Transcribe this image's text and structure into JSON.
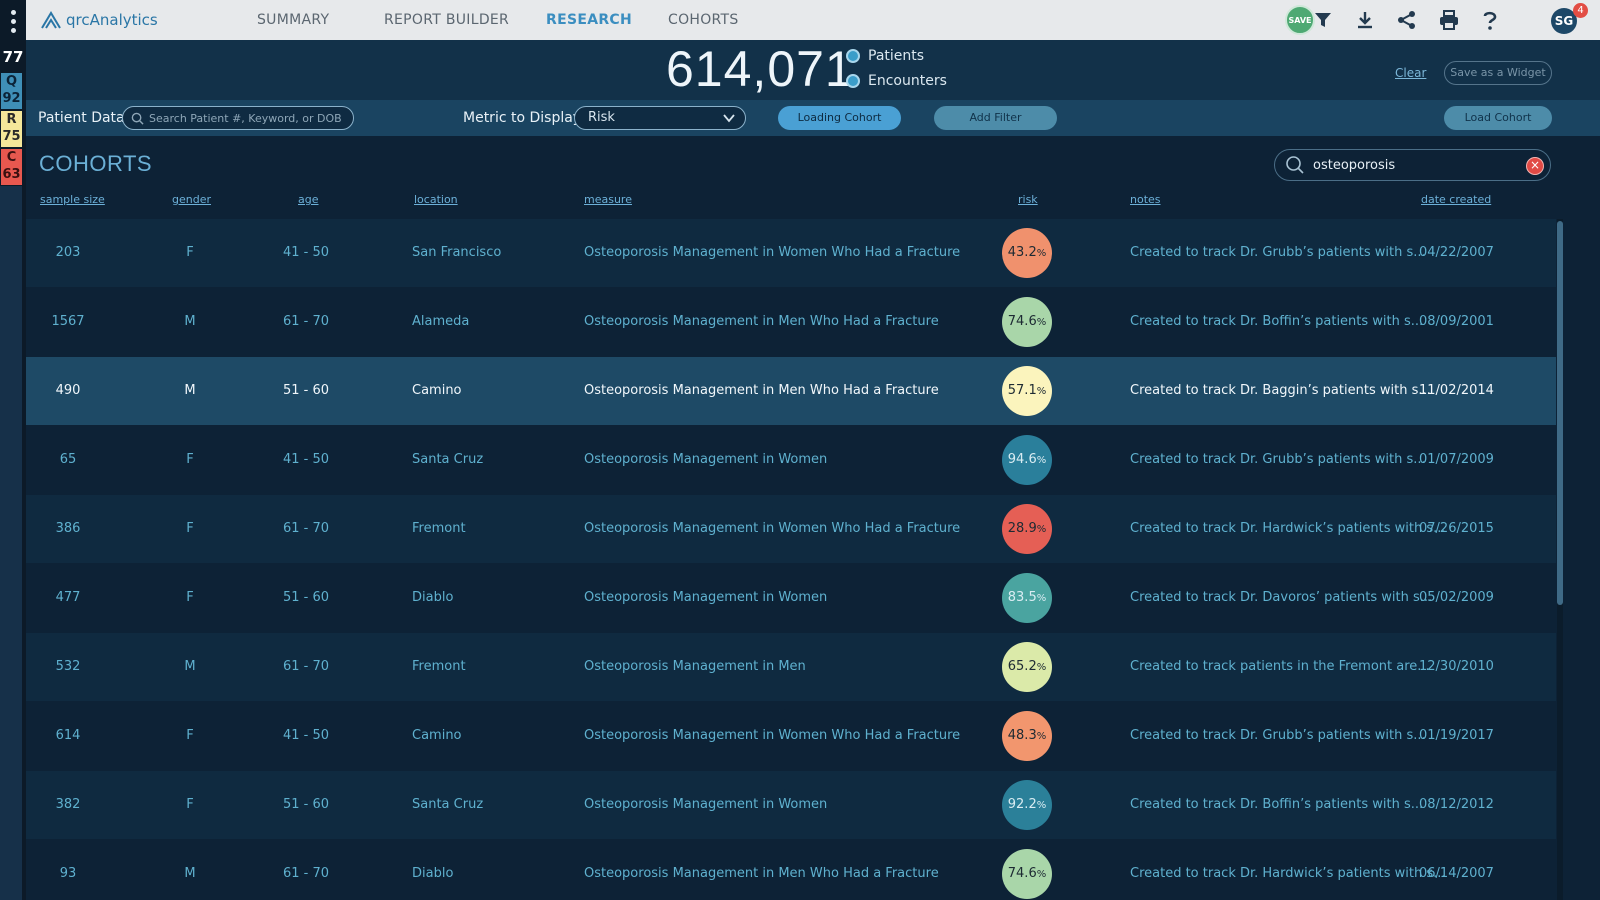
{
  "rail": {
    "total_score": "77",
    "metrics": [
      {
        "letter": "Q",
        "value": "92"
      },
      {
        "letter": "R",
        "value": "75"
      },
      {
        "letter": "C",
        "value": "63"
      }
    ]
  },
  "app": {
    "name": "qrcAnalytics"
  },
  "nav": {
    "tabs": [
      {
        "label": "SUMMARY"
      },
      {
        "label": "REPORT BUILDER"
      },
      {
        "label": "RESEARCH"
      },
      {
        "label": "COHORTS"
      }
    ],
    "active_tab": "RESEARCH",
    "save_label": "SAVE",
    "user_initials": "SG",
    "notification_count": "4",
    "icons": [
      "save-icon",
      "filter-icon",
      "download-icon",
      "share-icon",
      "print-icon",
      "help-icon"
    ]
  },
  "summary": {
    "count": "614,071",
    "radio_patients": "Patients",
    "radio_encounters": "Encounters",
    "clear_label": "Clear",
    "save_widget_label": "Save  as a Widget"
  },
  "filters": {
    "patient_data_label": "Patient Data",
    "search_placeholder": "Search Patient #, Keyword, or DOB",
    "metric_label": "Metric to Display",
    "metric_value": "Risk",
    "loading_cohort_label": "Loading Cohort",
    "add_filter_label": "Add Filter",
    "load_cohort_label": "Load Cohort"
  },
  "cohorts": {
    "title": "COHORTS",
    "search_value": "osteoporosis",
    "columns": [
      "sample size",
      "gender",
      "age",
      "location",
      "measure",
      "risk",
      "notes",
      "date created"
    ],
    "rows": [
      {
        "size": "203",
        "gender": "F",
        "age": "41 - 50",
        "location": "San Francisco",
        "measure": "Osteoporosis Management in Women Who Had a Fracture",
        "risk": "43.2",
        "risk_color": "#f0916d",
        "notes": "Created to track Dr. Grubb’s patients with s...",
        "date": "04/22/2007"
      },
      {
        "size": "1567",
        "gender": "M",
        "age": "61 - 70",
        "location": "Alameda",
        "measure": "Osteoporosis Management in Men Who Had a Fracture",
        "risk": "74.6",
        "risk_color": "#a9d6a9",
        "notes": "Created to track Dr. Boffin’s patients with s...",
        "date": "08/09/2001"
      },
      {
        "size": "490",
        "gender": "M",
        "age": "51 - 60",
        "location": "Camino",
        "measure": "Osteoporosis Management in Men Who Had a Fracture",
        "risk": "57.1",
        "risk_color": "#fbf4bd",
        "notes": "Created to track Dr. Baggin’s patients with s...",
        "date": "11/02/2014"
      },
      {
        "size": "65",
        "gender": "F",
        "age": "41 - 50",
        "location": "Santa Cruz",
        "measure": "Osteoporosis Management in Women",
        "risk": "94.6",
        "risk_color": "#2a7f9b",
        "notes": "Created to track Dr. Grubb’s patients with s...",
        "date": "01/07/2009"
      },
      {
        "size": "386",
        "gender": "F",
        "age": "61 - 70",
        "location": "Fremont",
        "measure": "Osteoporosis Management in Women Who Had a Fracture",
        "risk": "28.9",
        "risk_color": "#e55f55",
        "notes": "Created to track Dr. Hardwick’s patients with s...",
        "date": "07/26/2015"
      },
      {
        "size": "477",
        "gender": "F",
        "age": "51 - 60",
        "location": "Diablo",
        "measure": "Osteoporosis Management in Women",
        "risk": "83.5",
        "risk_color": "#4aa4a0",
        "notes": "Created to track Dr. Davoros’ patients with s...",
        "date": "05/02/2009"
      },
      {
        "size": "532",
        "gender": "M",
        "age": "61 - 70",
        "location": "Fremont",
        "measure": "Osteoporosis Management in Men",
        "risk": "65.2",
        "risk_color": "#dbeaa9",
        "notes": "Created to track patients in the Fremont are...",
        "date": "12/30/2010"
      },
      {
        "size": "614",
        "gender": "F",
        "age": "41 - 50",
        "location": "Camino",
        "measure": "Osteoporosis Management in Women Who Had a Fracture",
        "risk": "48.3",
        "risk_color": "#f2966e",
        "notes": "Created to track Dr. Grubb’s patients with s...",
        "date": "01/19/2017"
      },
      {
        "size": "382",
        "gender": "F",
        "age": "51 - 60",
        "location": "Santa Cruz",
        "measure": "Osteoporosis Management in Women",
        "risk": "92.2",
        "risk_color": "#2b8099",
        "notes": "Created to track Dr. Boffin’s patients with s...",
        "date": "08/12/2012"
      },
      {
        "size": "93",
        "gender": "M",
        "age": "61 - 70",
        "location": "Diablo",
        "measure": "Osteoporosis Management in Men Who Had a Fracture",
        "risk": "74.6",
        "risk_color": "#a9d6a9",
        "notes": "Created to track Dr. Hardwick’s patients with s...",
        "date": "06/14/2007"
      }
    ]
  },
  "colors": {
    "accent": "#3b8ec0",
    "nav_bg": "#e7e9eb",
    "page_bg": "#0d2236",
    "selected_row": "#1e4a66"
  }
}
